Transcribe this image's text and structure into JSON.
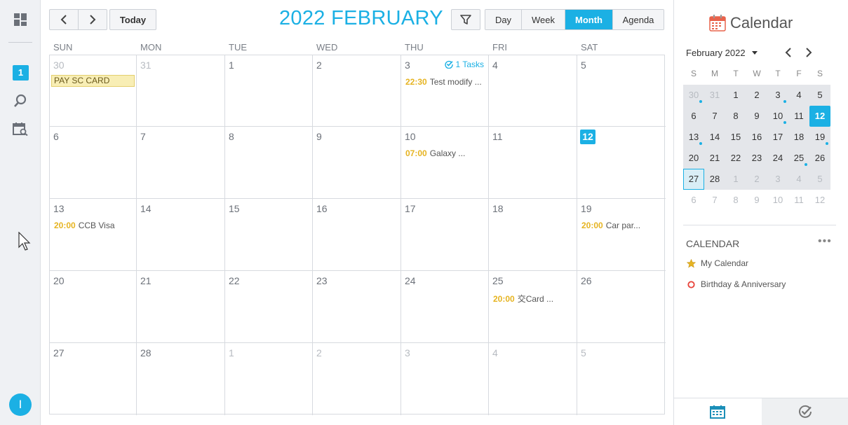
{
  "rail": {
    "badge": "1",
    "avatar_initial": "I"
  },
  "toolbar": {
    "today_label": "Today",
    "title": "2022 FEBRUARY",
    "views": [
      {
        "label": "Day",
        "active": false
      },
      {
        "label": "Week",
        "active": false
      },
      {
        "label": "Month",
        "active": true
      },
      {
        "label": "Agenda",
        "active": false
      }
    ]
  },
  "month": {
    "weekdays": [
      "SUN",
      "MON",
      "TUE",
      "WED",
      "THU",
      "FRI",
      "SAT"
    ],
    "weeks": [
      [
        {
          "day": "30",
          "muted": true,
          "allday": "PAY SC CARD"
        },
        {
          "day": "31",
          "muted": true
        },
        {
          "day": "1"
        },
        {
          "day": "2"
        },
        {
          "day": "3",
          "tasks": "1 Tasks",
          "event": {
            "time": "22:30",
            "title": "Test modify ..."
          }
        },
        {
          "day": "4"
        },
        {
          "day": "5"
        }
      ],
      [
        {
          "day": "6"
        },
        {
          "day": "7"
        },
        {
          "day": "8"
        },
        {
          "day": "9"
        },
        {
          "day": "10",
          "event": {
            "time": "07:00",
            "title": "Galaxy ..."
          }
        },
        {
          "day": "11"
        },
        {
          "day": "12",
          "today": true
        }
      ],
      [
        {
          "day": "13",
          "event": {
            "time": "20:00",
            "title": "CCB Visa"
          }
        },
        {
          "day": "14"
        },
        {
          "day": "15"
        },
        {
          "day": "16"
        },
        {
          "day": "17"
        },
        {
          "day": "18"
        },
        {
          "day": "19",
          "event": {
            "time": "20:00",
            "title": "Car par..."
          }
        }
      ],
      [
        {
          "day": "20"
        },
        {
          "day": "21"
        },
        {
          "day": "22"
        },
        {
          "day": "23"
        },
        {
          "day": "24"
        },
        {
          "day": "25",
          "event": {
            "time": "20:00",
            "title": "交Card ..."
          }
        },
        {
          "day": "26"
        }
      ],
      [
        {
          "day": "27"
        },
        {
          "day": "28"
        },
        {
          "day": "1",
          "muted": true
        },
        {
          "day": "2",
          "muted": true
        },
        {
          "day": "3",
          "muted": true
        },
        {
          "day": "4",
          "muted": true
        },
        {
          "day": "5",
          "muted": true
        }
      ]
    ]
  },
  "side": {
    "title": "Calendar",
    "mini_month_label": "February 2022",
    "mini_weekdays": [
      "S",
      "M",
      "T",
      "W",
      "T",
      "F",
      "S"
    ],
    "mini_weeks": [
      [
        {
          "d": "30",
          "m": true,
          "dot": true
        },
        {
          "d": "31",
          "m": true
        },
        {
          "d": "1"
        },
        {
          "d": "2"
        },
        {
          "d": "3",
          "dot": true
        },
        {
          "d": "4"
        },
        {
          "d": "5"
        }
      ],
      [
        {
          "d": "6"
        },
        {
          "d": "7"
        },
        {
          "d": "8"
        },
        {
          "d": "9"
        },
        {
          "d": "10",
          "dot": true
        },
        {
          "d": "11"
        },
        {
          "d": "12",
          "sel": true
        }
      ],
      [
        {
          "d": "13",
          "dot": true
        },
        {
          "d": "14"
        },
        {
          "d": "15"
        },
        {
          "d": "16"
        },
        {
          "d": "17"
        },
        {
          "d": "18"
        },
        {
          "d": "19",
          "dot": true
        }
      ],
      [
        {
          "d": "20"
        },
        {
          "d": "21"
        },
        {
          "d": "22"
        },
        {
          "d": "23"
        },
        {
          "d": "24"
        },
        {
          "d": "25",
          "dot": true
        },
        {
          "d": "26"
        }
      ],
      [
        {
          "d": "27",
          "today": true
        },
        {
          "d": "28"
        },
        {
          "d": "1",
          "m": true
        },
        {
          "d": "2",
          "m": true
        },
        {
          "d": "3",
          "m": true
        },
        {
          "d": "4",
          "m": true
        },
        {
          "d": "5",
          "m": true
        }
      ],
      [
        {
          "d": "6",
          "m": true
        },
        {
          "d": "7",
          "m": true
        },
        {
          "d": "8",
          "m": true
        },
        {
          "d": "9",
          "m": true
        },
        {
          "d": "10",
          "m": true
        },
        {
          "d": "11",
          "m": true
        },
        {
          "d": "12",
          "m": true
        }
      ]
    ],
    "calendar_section": "CALENDAR",
    "calendars": [
      {
        "label": "My Calendar",
        "icon": "star-icon",
        "color": "#e6b422"
      },
      {
        "label": "Birthday & Anniversary",
        "icon": "circle-icon",
        "color": "#e8453c"
      }
    ]
  },
  "colors": {
    "accent": "#1bb0e4",
    "event_time": "#e6b422"
  }
}
